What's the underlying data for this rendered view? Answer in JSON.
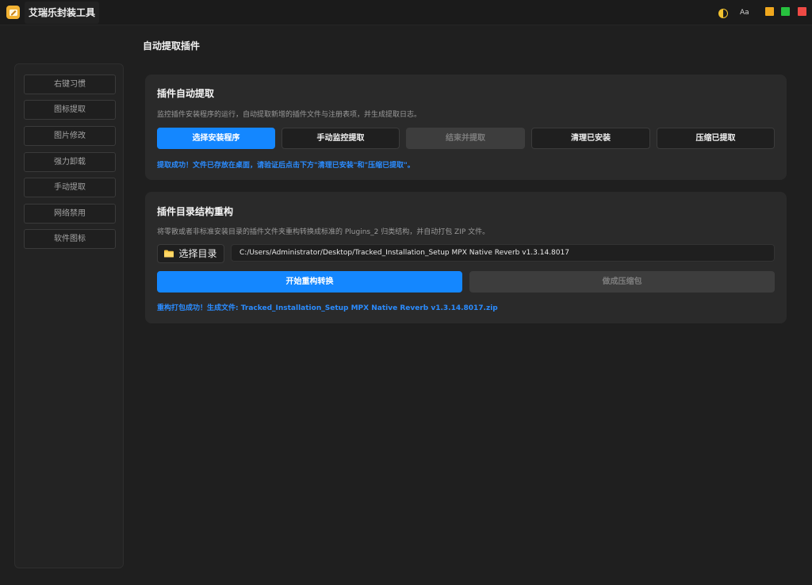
{
  "app": {
    "title": "艾瑞乐封装工具"
  },
  "titlebar": {
    "lang_label": "Aa"
  },
  "colors": {
    "accent": "#1487ff",
    "status": "#2b8cff",
    "min": "#f0a81e",
    "max": "#27c13e",
    "close": "#ef4a45"
  },
  "sidebar": {
    "items": [
      {
        "label": "右键习惯"
      },
      {
        "label": "图标提取"
      },
      {
        "label": "图片修改"
      },
      {
        "label": "强力卸载"
      },
      {
        "label": "手动提取"
      },
      {
        "label": "网络禁用"
      },
      {
        "label": "软件图标"
      }
    ]
  },
  "page": {
    "title": "自动提取插件"
  },
  "auto_extract": {
    "title": "插件自动提取",
    "description": "监控插件安装程序的运行，自动提取新增的插件文件与注册表项，并生成提取日志。",
    "buttons": {
      "select_installer": "选择安装程序",
      "manual_monitor": "手动监控提取",
      "stop_extract": "结束并提取",
      "clean_installed": "清理已安装",
      "compress_extracted": "压缩已提取"
    },
    "status": "提取成功！文件已存放在桌面，请验证后点击下方\"清理已安装\"和\"压缩已提取\"。"
  },
  "restructure": {
    "title": "插件目录结构重构",
    "description": "将零散或者非标准安装目录的插件文件夹重构转换成标准的 Plugins_2 归类结构，并自动打包 ZIP 文件。",
    "select_dir": "选择目录",
    "path_value": "C:/Users/Administrator/Desktop/Tracked_Installation_Setup MPX Native Reverb v1.3.14.8017",
    "start_button": "开始重构转换",
    "zip_button": "做成压缩包",
    "status": "重构打包成功！生成文件: Tracked_Installation_Setup MPX Native Reverb v1.3.14.8017.zip"
  }
}
